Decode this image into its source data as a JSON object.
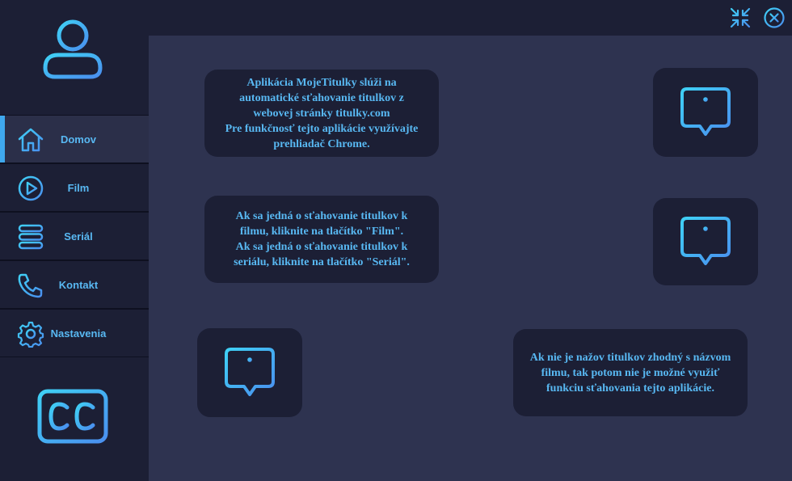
{
  "sidebar": {
    "items": [
      {
        "label": "Domov",
        "icon": "home-icon",
        "active": true
      },
      {
        "label": "Film",
        "icon": "play-icon",
        "active": false
      },
      {
        "label": "Seriál",
        "icon": "stack-icon",
        "active": false
      },
      {
        "label": "Kontakt",
        "icon": "phone-icon",
        "active": false
      },
      {
        "label": "Nastavenia",
        "icon": "gear-icon",
        "active": false
      }
    ]
  },
  "window": {
    "controls": [
      "shrink-icon",
      "close-icon"
    ]
  },
  "cards": {
    "intro": "Aplikácia MojeTitulky slúži na\nautomatické sťahovanie titulkov  z\nwebovej stránky titulky.com\nPre funkčnosť tejto aplikácie využívajte\nprehliadač Chrome.",
    "usage": "Ak sa jedná o sťahovanie titulkov k\nfilmu, kliknite na tlačítko \"Film\".\nAk sa jedná o sťahovanie titulkov k\nseriálu, kliknite na tlačítko \"Seriál\".",
    "warning": "Ak nie je nažov titulkov zhodný s názvom\nfilmu, tak potom nie je možné využiť\nfunkciu sťahovania tejto aplikácie."
  },
  "colors": {
    "accent": "#58b8f2",
    "gradient_start": "#3fd0f5",
    "gradient_end": "#4a8fef",
    "sidebar_bg": "#1c1f35",
    "main_bg": "#2e3350"
  }
}
